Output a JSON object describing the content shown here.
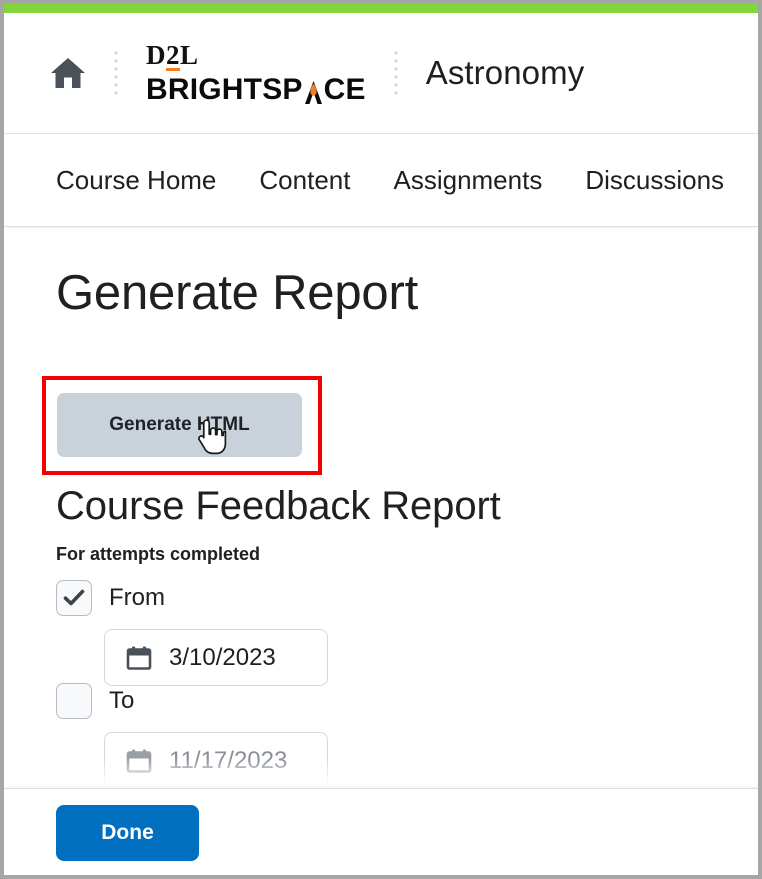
{
  "window": {
    "accent_bar_color": "#82d63c",
    "frame_border_color": "#a6a6a6"
  },
  "header": {
    "home_icon": "home-icon",
    "logo": {
      "line1_prefix": "D",
      "line1_digit": "2",
      "line1_suffix": "L",
      "line2_part1": "BRIGHTSP",
      "line2_flame": "flame-a-icon",
      "line2_part2": "CE",
      "accent_color": "#f47e20"
    },
    "course_title": "Astronomy"
  },
  "course_nav": {
    "items": [
      {
        "label": "Course Home"
      },
      {
        "label": "Content"
      },
      {
        "label": "Assignments"
      },
      {
        "label": "Discussions"
      }
    ]
  },
  "main": {
    "page_title": "Generate Report",
    "generate_button": {
      "label": "Generate HTML",
      "background": "#c9d2da",
      "text_color": "#1f2226"
    },
    "highlight": {
      "color": "#f40000"
    },
    "cursor": "pointer-hand-cursor",
    "section_title": "Course Feedback Report",
    "attempts_label": "For attempts completed",
    "date_filters": [
      {
        "id": "from",
        "checkbox_label": "From",
        "checked": true,
        "checkbox_icon": "checkmark-icon",
        "calendar_icon": "calendar-icon",
        "date_value": "3/10/2023"
      },
      {
        "id": "to",
        "checkbox_label": "To",
        "checked": false,
        "checkbox_icon": "",
        "calendar_icon": "calendar-icon",
        "date_value": "11/17/2023"
      }
    ]
  },
  "footer": {
    "done_button": {
      "label": "Done",
      "background": "#006fbf",
      "text_color": "#ffffff"
    }
  }
}
